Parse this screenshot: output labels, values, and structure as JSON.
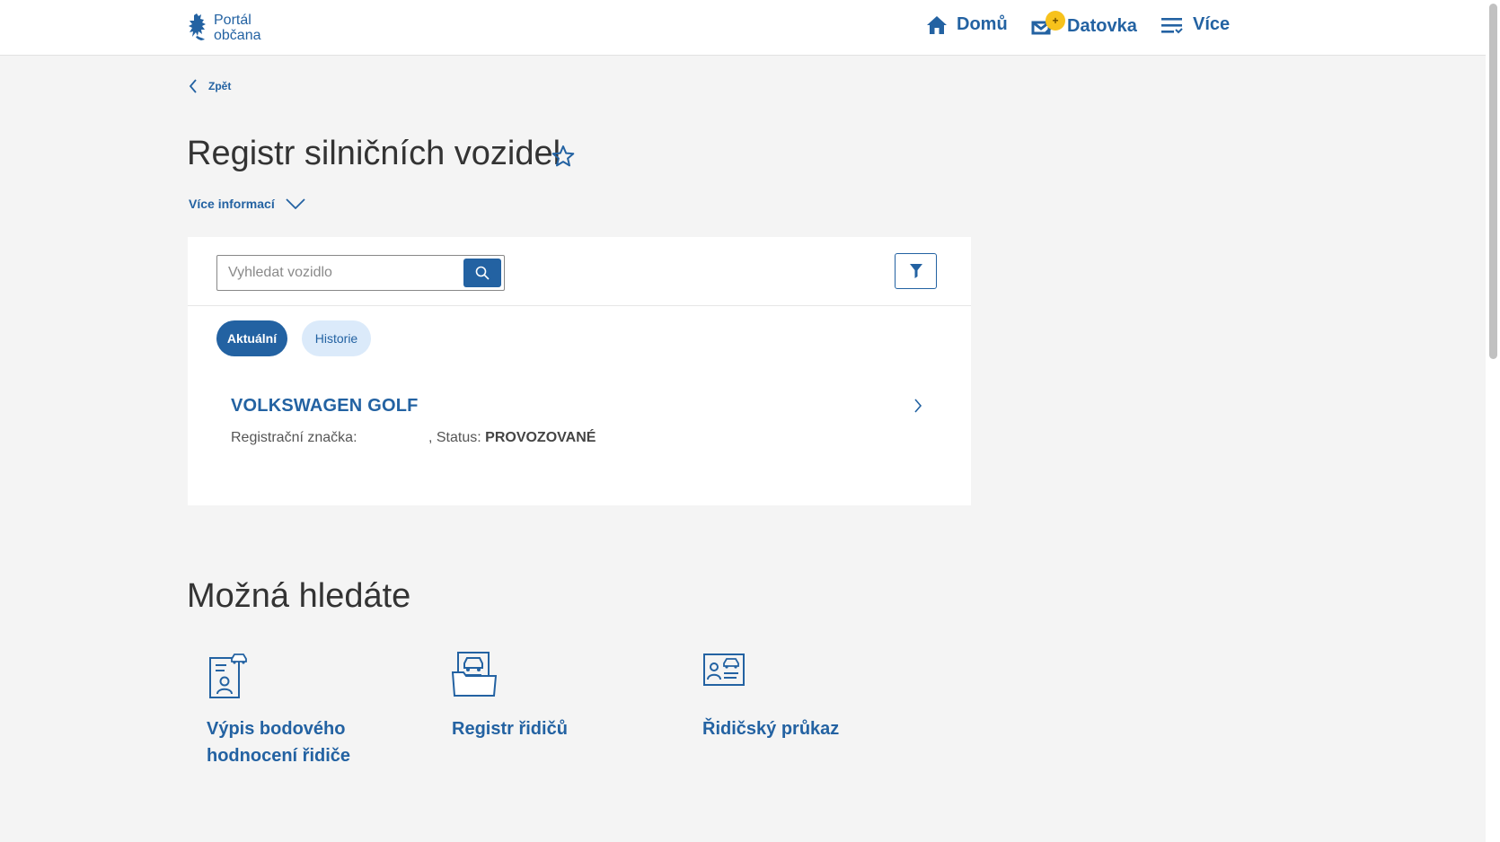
{
  "header": {
    "logo_line1": "Portál",
    "logo_line2": "občana",
    "nav": [
      {
        "label": "Domů",
        "icon": "home-icon"
      },
      {
        "label": "Datovka",
        "icon": "mail-icon",
        "badge": "+"
      },
      {
        "label": "Více",
        "icon": "menu-icon"
      }
    ]
  },
  "breadcrumb": {
    "back_label": "Zpět"
  },
  "page": {
    "title": "Registr silničních vozidel",
    "more_info_label": "Více informací"
  },
  "search": {
    "placeholder": "Vyhledat vozidlo",
    "value": ""
  },
  "tabs": [
    {
      "label": "Aktuální",
      "active": true
    },
    {
      "label": "Historie",
      "active": false
    }
  ],
  "vehicles": [
    {
      "name": "VOLKSWAGEN GOLF",
      "plate_label": "Registrační značka:",
      "plate_value": "",
      "separator": ",",
      "status_label": "Status:",
      "status_value": "PROVOZOVANÉ"
    }
  ],
  "suggestions": {
    "title": "Možná hledáte",
    "items": [
      {
        "line1": "Výpis bodového",
        "line2": "hodnocení řidiče",
        "icon": "driver-points-icon"
      },
      {
        "line1": "Registr řidičů",
        "icon": "driver-register-icon"
      },
      {
        "line1": "Řidičský průkaz",
        "icon": "driver-license-icon"
      }
    ]
  },
  "colors": {
    "primary": "#2362a2",
    "background": "#f4f4f4",
    "badge": "#f7c21c",
    "pill_inactive": "#dbeafa"
  }
}
